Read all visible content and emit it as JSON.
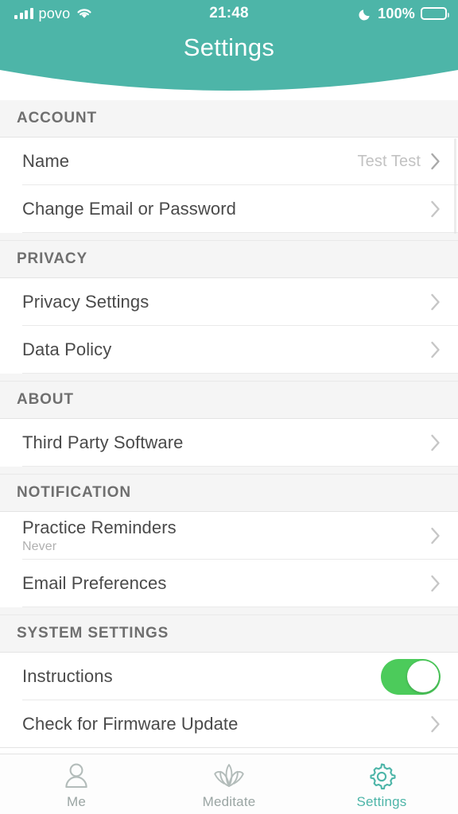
{
  "status_bar": {
    "carrier": "povo",
    "time": "21:48",
    "battery_percent": "100%",
    "signal_icon": "signal-bars-icon",
    "wifi_icon": "wifi-icon",
    "dnd_icon": "moon-icon",
    "battery_icon": "battery-full-icon"
  },
  "header": {
    "title": "Settings",
    "background_color": "#4db5a8",
    "text_color": "#ffffff"
  },
  "sections": [
    {
      "id": "account",
      "title": "ACCOUNT",
      "rows": [
        {
          "label": "Name",
          "value": "Test Test",
          "accessory": "chevron"
        },
        {
          "label": "Change Email or Password",
          "value": "",
          "accessory": "chevron"
        }
      ]
    },
    {
      "id": "privacy",
      "title": "PRIVACY",
      "rows": [
        {
          "label": "Privacy Settings",
          "value": "",
          "accessory": "chevron"
        },
        {
          "label": "Data Policy",
          "value": "",
          "accessory": "chevron"
        }
      ]
    },
    {
      "id": "about",
      "title": "ABOUT",
      "rows": [
        {
          "label": "Third Party Software",
          "value": "",
          "accessory": "chevron"
        }
      ]
    },
    {
      "id": "notification",
      "title": "NOTIFICATION",
      "rows": [
        {
          "label": "Practice Reminders",
          "subtitle": "Never",
          "value": "",
          "accessory": "chevron"
        },
        {
          "label": "Email Preferences",
          "value": "",
          "accessory": "chevron"
        }
      ]
    },
    {
      "id": "system-settings",
      "title": "SYSTEM SETTINGS",
      "rows": [
        {
          "label": "Instructions",
          "value": "",
          "accessory": "toggle",
          "toggle_on": true
        },
        {
          "label": "Check for Firmware Update",
          "value": "",
          "accessory": "chevron"
        }
      ]
    }
  ],
  "tab_bar": {
    "active": "settings",
    "active_color": "#4db5a8",
    "inactive_color": "#9aa5a3",
    "tabs": [
      {
        "id": "me",
        "label": "Me",
        "icon": "person-icon"
      },
      {
        "id": "meditate",
        "label": "Meditate",
        "icon": "lotus-icon"
      },
      {
        "id": "settings",
        "label": "Settings",
        "icon": "gear-icon"
      }
    ]
  },
  "colors": {
    "header_teal": "#4db5a8",
    "toggle_green": "#4ccb5b",
    "section_header_bg": "#f5f5f5",
    "section_header_text": "#6f6f6f",
    "row_text": "#4a4a4a",
    "muted_text": "#c2c2c2"
  }
}
